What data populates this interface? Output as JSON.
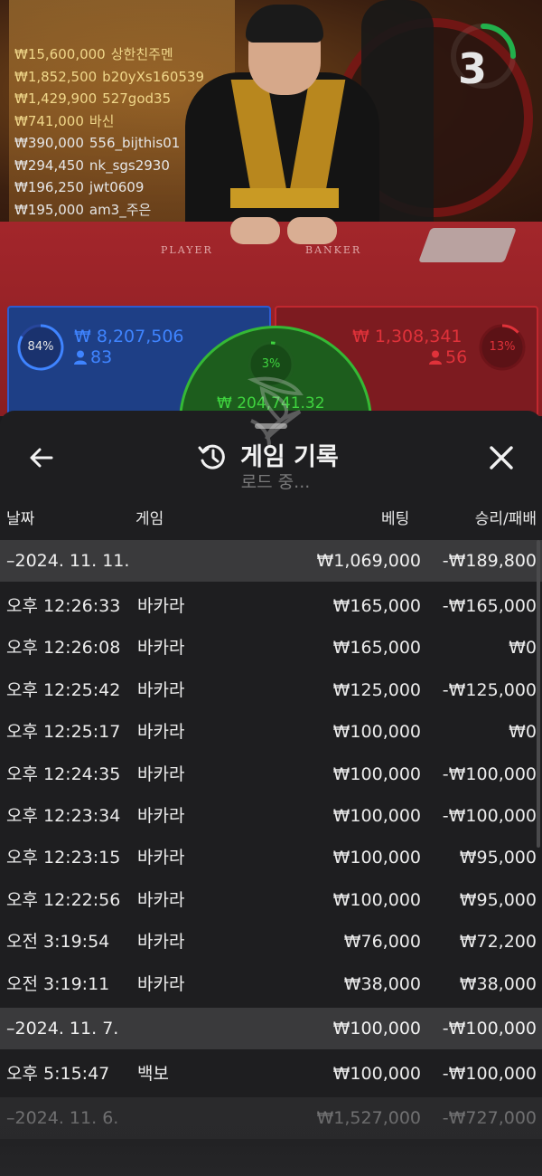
{
  "video": {
    "felt_player_label": "PLAYER",
    "felt_banker_label": "BANKER",
    "timer": "3",
    "leaderboard": [
      {
        "amount": "₩15,600,000",
        "name": "상한친주멘",
        "style": "gold"
      },
      {
        "amount": "₩1,852,500",
        "name": "b20yXs160539",
        "style": "gold"
      },
      {
        "amount": "₩1,429,900",
        "name": "527god35",
        "style": "gold"
      },
      {
        "amount": "₩741,000",
        "name": "바신",
        "style": "gold"
      },
      {
        "amount": "₩390,000",
        "name": "556_bijthis01",
        "style": "white"
      },
      {
        "amount": "₩294,450",
        "name": "nk_sgs2930",
        "style": "white"
      },
      {
        "amount": "₩196,250",
        "name": "jwt0609",
        "style": "white"
      },
      {
        "amount": "₩195,000",
        "name": "am3_주은",
        "style": "white"
      }
    ]
  },
  "bets": {
    "player": {
      "percent": "84%",
      "amount": "₩ 8,207,506",
      "count": "83",
      "color": "#3f84ff",
      "percent_value": 84
    },
    "banker": {
      "percent": "13%",
      "amount": "₩ 1,308,341",
      "count": "56",
      "color": "#e0323a",
      "percent_value": 13
    },
    "tie": {
      "percent": "3%",
      "amount": "₩ 204,741.32",
      "color": "#3fd43f",
      "percent_value": 3
    }
  },
  "sheet": {
    "title": "게임 기록",
    "columns": {
      "date": "날짜",
      "game": "게임",
      "bet": "베팅",
      "result": "승리/패배"
    },
    "loading_text": "로드 중...",
    "days": [
      {
        "date": "–2024. 11. 11.",
        "bet": "₩1,069,000",
        "result": "-₩189,800",
        "games": [
          {
            "time": "오후 12:26:33",
            "game": "바카라",
            "bet": "₩165,000",
            "result": "-₩165,000"
          },
          {
            "time": "오후 12:26:08",
            "game": "바카라",
            "bet": "₩165,000",
            "result": "₩0"
          },
          {
            "time": "오후 12:25:42",
            "game": "바카라",
            "bet": "₩125,000",
            "result": "-₩125,000"
          },
          {
            "time": "오후 12:25:17",
            "game": "바카라",
            "bet": "₩100,000",
            "result": "₩0"
          },
          {
            "time": "오후 12:24:35",
            "game": "바카라",
            "bet": "₩100,000",
            "result": "-₩100,000"
          },
          {
            "time": "오후 12:23:34",
            "game": "바카라",
            "bet": "₩100,000",
            "result": "-₩100,000"
          },
          {
            "time": "오후 12:23:15",
            "game": "바카라",
            "bet": "₩100,000",
            "result": "₩95,000"
          },
          {
            "time": "오후 12:22:56",
            "game": "바카라",
            "bet": "₩100,000",
            "result": "₩95,000"
          },
          {
            "time": "오전 3:19:54",
            "game": "바카라",
            "bet": "₩76,000",
            "result": "₩72,200"
          },
          {
            "time": "오전 3:19:11",
            "game": "바카라",
            "bet": "₩38,000",
            "result": "₩38,000"
          }
        ]
      },
      {
        "date": "–2024. 11. 7.",
        "bet": "₩100,000",
        "result": "-₩100,000",
        "games": [
          {
            "time": "오후 5:15:47",
            "game": "백보",
            "bet": "₩100,000",
            "result": "-₩100,000"
          }
        ]
      },
      {
        "date": "–2024. 11. 6.",
        "bet": "₩1,527,000",
        "result": "-₩727,000",
        "games": []
      }
    ]
  }
}
